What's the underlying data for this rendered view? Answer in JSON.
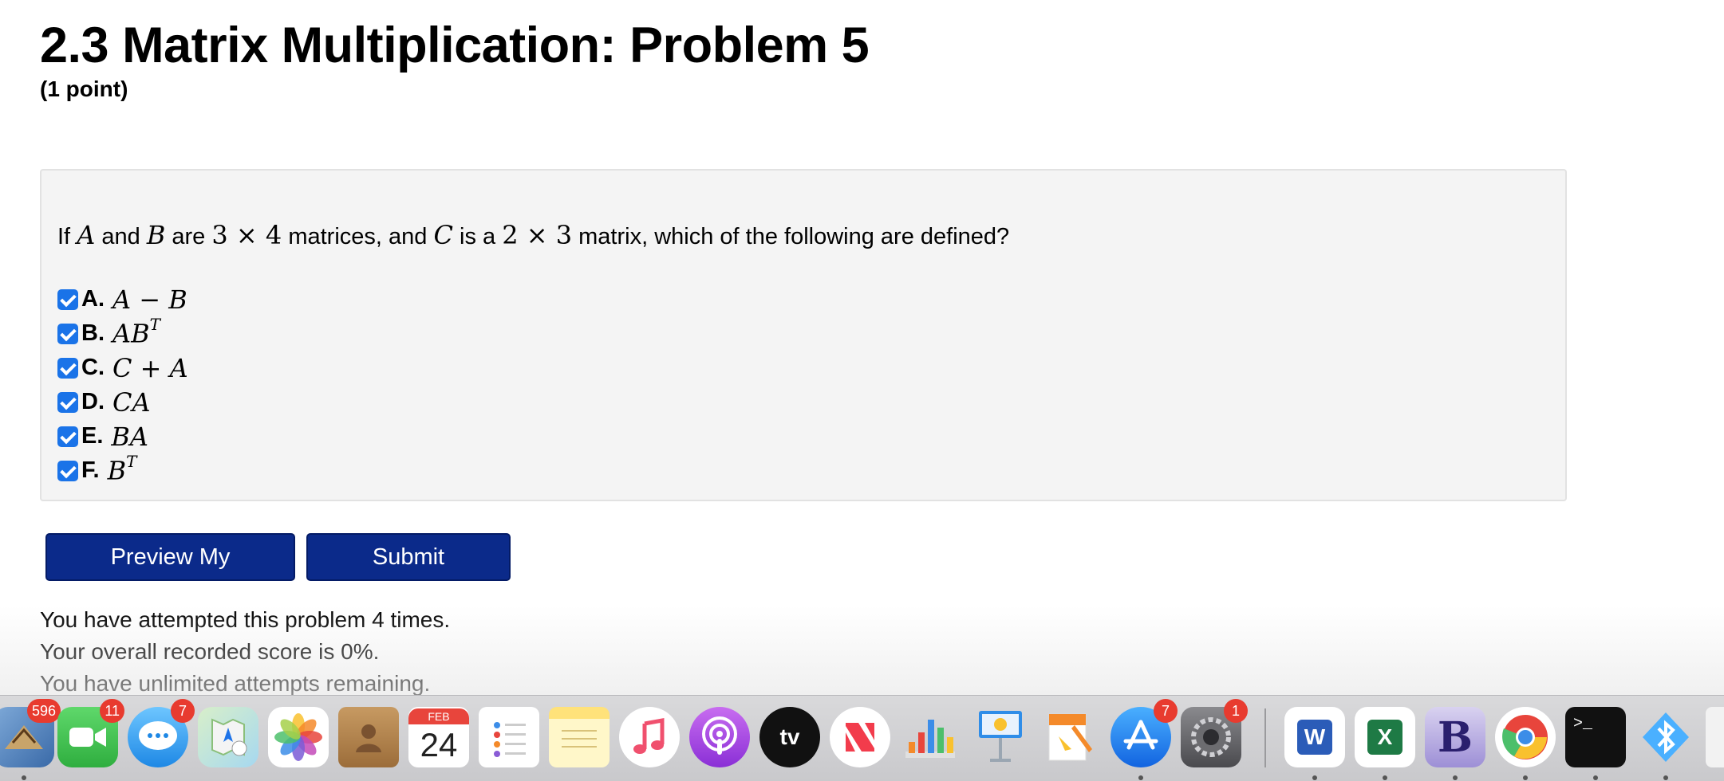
{
  "header": {
    "title": "2.3 Matrix Multiplication: Problem 5",
    "points": "(1 point)"
  },
  "question": {
    "prefix": "If",
    "var_a": "A",
    "and1": "and",
    "var_b": "B",
    "are": "are",
    "dim1": "3 × 4",
    "matrices": "matrices, and",
    "var_c": "C",
    "is_a": "is a",
    "dim2": "2 × 3",
    "suffix": "matrix, which of the following are defined?"
  },
  "options": [
    {
      "letter": "A.",
      "expr": "A − B",
      "sup": "",
      "checked": true
    },
    {
      "letter": "B.",
      "expr": "AB",
      "sup": "T",
      "checked": true
    },
    {
      "letter": "C.",
      "expr": "C + A",
      "sup": "",
      "checked": true
    },
    {
      "letter": "D.",
      "expr": "CA",
      "sup": "",
      "checked": true
    },
    {
      "letter": "E.",
      "expr": "BA",
      "sup": "",
      "checked": true
    },
    {
      "letter": "F.",
      "expr": "B",
      "sup": "T",
      "checked": true
    }
  ],
  "buttons": {
    "preview": "Preview My Answers",
    "submit": "Submit Answers"
  },
  "status": {
    "attempts": "You have attempted this problem 4 times.",
    "score": "Your overall recorded score is 0%.",
    "remaining": "You have unlimited attempts remaining."
  },
  "dock": {
    "badges": {
      "mail": "596",
      "facetime": "11",
      "messages": "7",
      "appstore": "7",
      "settings": "1"
    },
    "calendar_month": "FEB",
    "calendar_day": "24",
    "tv_label": "tv",
    "word_letter": "W",
    "excel_letter": "X",
    "bbedit_letter": "B",
    "terminal_prompt": ">_",
    "colors": {
      "accent": "#0b2a8a",
      "checkbox": "#1a73e8",
      "badge": "#e83b2f"
    }
  }
}
